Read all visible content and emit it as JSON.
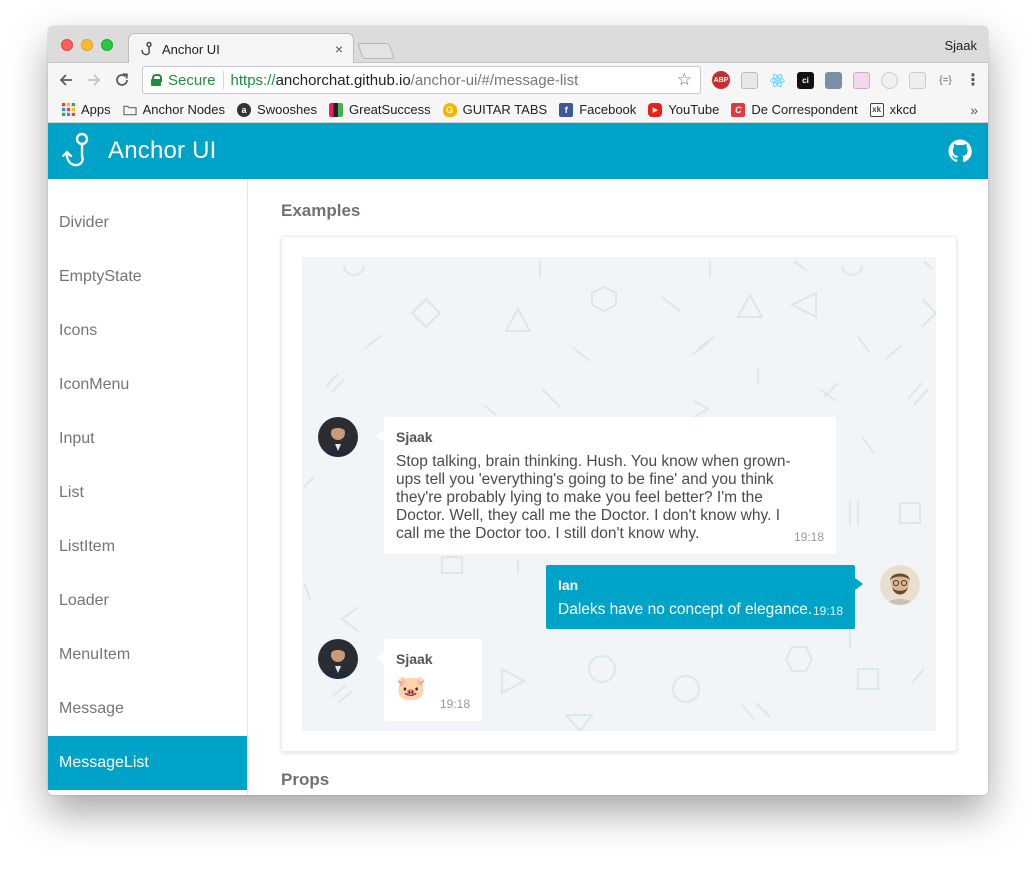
{
  "browser": {
    "tab_title": "Anchor UI",
    "tab_close": "×",
    "profile_name": "Sjaak",
    "secure_label": "Secure",
    "url": {
      "scheme": "https://",
      "host": "anchorchat.github.io",
      "path": "/anchor-ui/#/message-list"
    },
    "extensions": [
      "ABP",
      "qr-icon",
      "react-icon",
      "ci-icon",
      "puzzle-icon",
      "unicorn-icon",
      "timer-icon",
      "window-icon",
      "json-icon"
    ],
    "bookmarks": [
      {
        "label": "Apps",
        "icon": "apps-grid-icon",
        "color": "#e94235"
      },
      {
        "label": "Anchor Nodes",
        "icon": "folder-icon",
        "color": "#777777"
      },
      {
        "label": "Swooshes",
        "icon": "swoosh-icon",
        "color": "#333333"
      },
      {
        "label": "GreatSuccess",
        "icon": "greatsuccess-icon",
        "color": "#222222"
      },
      {
        "label": "GUITAR TABS",
        "icon": "guitar-tabs-icon",
        "color": "#f4b400"
      },
      {
        "label": "Facebook",
        "icon": "facebook-icon",
        "color": "#3b5998"
      },
      {
        "label": "YouTube",
        "icon": "youtube-icon",
        "color": "#e62117"
      },
      {
        "label": "De Correspondent",
        "icon": "decorrespondent-icon",
        "color": "#e0393e"
      },
      {
        "label": "xkcd",
        "icon": "xkcd-icon",
        "color": "#444444"
      }
    ],
    "bookmarks_more": "»"
  },
  "app": {
    "title": "Anchor UI",
    "accent": "#00a3c8"
  },
  "sidebar": {
    "items": [
      {
        "label": "Divider",
        "active": false
      },
      {
        "label": "EmptyState",
        "active": false
      },
      {
        "label": "Icons",
        "active": false
      },
      {
        "label": "IconMenu",
        "active": false
      },
      {
        "label": "Input",
        "active": false
      },
      {
        "label": "List",
        "active": false
      },
      {
        "label": "ListItem",
        "active": false
      },
      {
        "label": "Loader",
        "active": false
      },
      {
        "label": "MenuItem",
        "active": false
      },
      {
        "label": "Message",
        "active": false
      },
      {
        "label": "MessageList",
        "active": true
      }
    ]
  },
  "main": {
    "examples_title": "Examples",
    "props_title": "Props",
    "messages": [
      {
        "sender": "Sjaak",
        "body": "Stop talking, brain thinking. Hush. You know when grown-ups tell you 'everything's going to be fine' and you think they're probably lying to make you feel better? I'm the Doctor. Well, they call me the Doctor. I don't know why. I call me the Doctor too. I still don't know why.",
        "time": "19:18",
        "own": false
      },
      {
        "sender": "Ian",
        "body": "Daleks have no concept of elegance.",
        "time": "19:18",
        "own": true
      },
      {
        "sender": "Sjaak",
        "body": "🐷",
        "time": "19:18",
        "own": false
      }
    ]
  }
}
